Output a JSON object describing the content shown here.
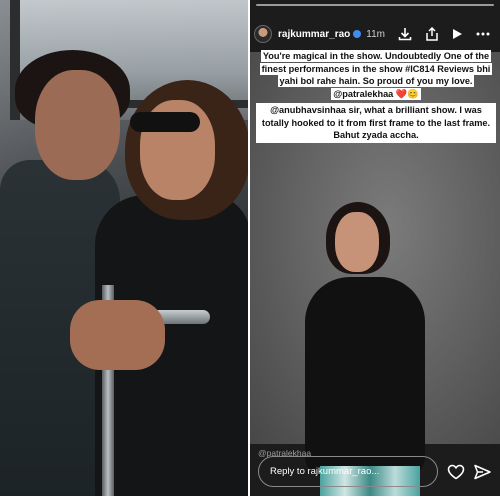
{
  "story": {
    "username": "rajkummar_rao",
    "time": "11m",
    "caption_line1": "You're magical in the show. Undoubtedly One of the finest performances in the show #IC814 Reviews bhi yahi bol rahe hain. So proud of you my love. @patralekhaa ❤️😊",
    "caption_line2": "@anubhavsinhaa  sir, what a brilliant show. I was totally hooked to it from first frame to the last frame. Bahut zyada accha.",
    "mention": "@patralekhaa",
    "reply_placeholder": "Reply to rajkummar_rao...",
    "icons": {
      "download": "download-icon",
      "share": "share-icon",
      "play": "play-icon",
      "more": "more-icon",
      "like": "heart-icon",
      "send": "send-icon"
    }
  }
}
